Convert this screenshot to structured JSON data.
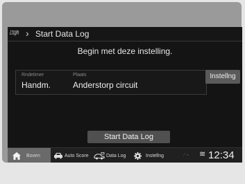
{
  "header": {
    "logo_mini": "Honda",
    "logo_brand": "LogR",
    "title": "Start Data Log"
  },
  "prompt": "Begin met deze instelling.",
  "settings_panel": {
    "timer_label": "Rndetimer",
    "timer_value": "Handm.",
    "place_label": "Plaats",
    "place_value": "Anderstorp circuit",
    "settings_button": "Instellng"
  },
  "start_button": "Start Data Log",
  "navbar": {
    "items": [
      {
        "label": "Boven",
        "icon": "home-icon",
        "active": true
      },
      {
        "label": "Auto Score",
        "icon": "car-icon",
        "active": false
      },
      {
        "label": "Data Log",
        "icon": "race-car-icon",
        "active": false
      },
      {
        "label": "Instellng",
        "icon": "gear-icon",
        "active": false
      }
    ]
  },
  "status": {
    "clock": "12:34",
    "wifi_icon": "wifi-icon"
  }
}
